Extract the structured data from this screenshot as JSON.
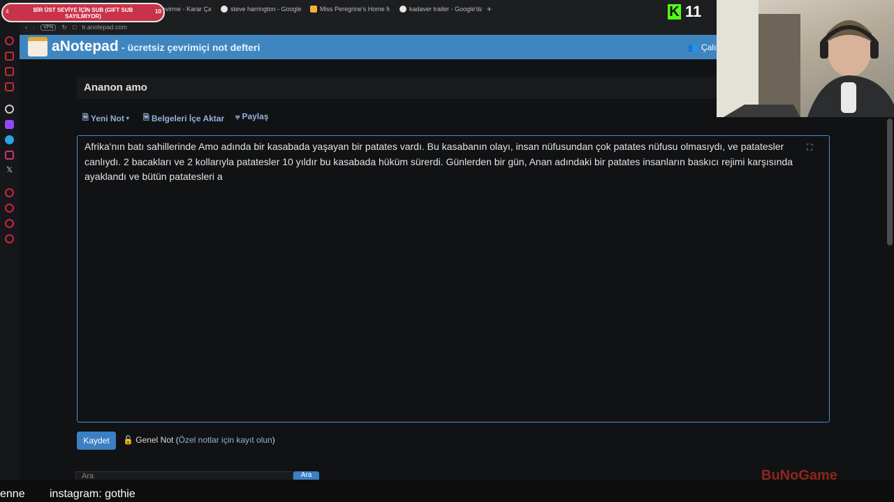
{
  "browser": {
    "tabs": [
      {
        "label": "Çark Çevirme - Karar Çark",
        "icon_color": "#e25555"
      },
      {
        "label": "steve harrington - Google",
        "icon_color": "#e6e6e6"
      },
      {
        "label": "Miss Peregrine's Home fo",
        "icon_color": "#f0b23a"
      },
      {
        "label": "kadaver trailer - Google'da",
        "icon_color": "#e6e6e6"
      }
    ],
    "new_tab": "+",
    "vpn_badge": "VPN",
    "url": "tr.anotepad.com"
  },
  "site": {
    "brand": "aNotepad",
    "tagline": "- ücretsiz çevrimiçi not defteri",
    "workspace_label": "Çalış"
  },
  "note": {
    "title": "Ananon amo",
    "toolbar": {
      "new_note": "Yeni Not",
      "import_docs": "Belgeleri İçe Aktar",
      "share": "Paylaş"
    },
    "content": "Afrika'nın batı sahillerinde Amo adında bir kasabada yaşayan bir patates vardı. Bu kasabanın olayı, insan nüfusundan çok patates nüfusu olmasıydı, ve patatesler canlıydı. 2 bacakları ve 2 kollarıyla patatesler 10 yıldır bu kasabada hüküm sürerdi. Günlerden bir gün, Anan adındaki bir patates insanların baskıcı rejimi karşısında ayaklandı ve bütün patatesleri a",
    "save_label": "Kaydet",
    "visibility": "Genel Not",
    "private_hint": "Özel notlar için kayıt olun",
    "search_placeholder": "Ara",
    "search_button": "Ara"
  },
  "overlay": {
    "sub_goal_text": "BİR ÜST SEVİYE İÇİN SUB (GIFT SUB SAYILMIYOR)",
    "sub_goal_left": "4",
    "sub_goal_right": "10",
    "kick_count": "11",
    "ticker": [
      "enne",
      "instagram: gothie"
    ],
    "watermark": "BuNoGame"
  },
  "colors": {
    "header": "#3f86c0",
    "link": "#8fb3dc",
    "accent_button": "#3d7fc4",
    "kick_green": "#53fc18",
    "sidebar_icon": "#c8283c"
  }
}
